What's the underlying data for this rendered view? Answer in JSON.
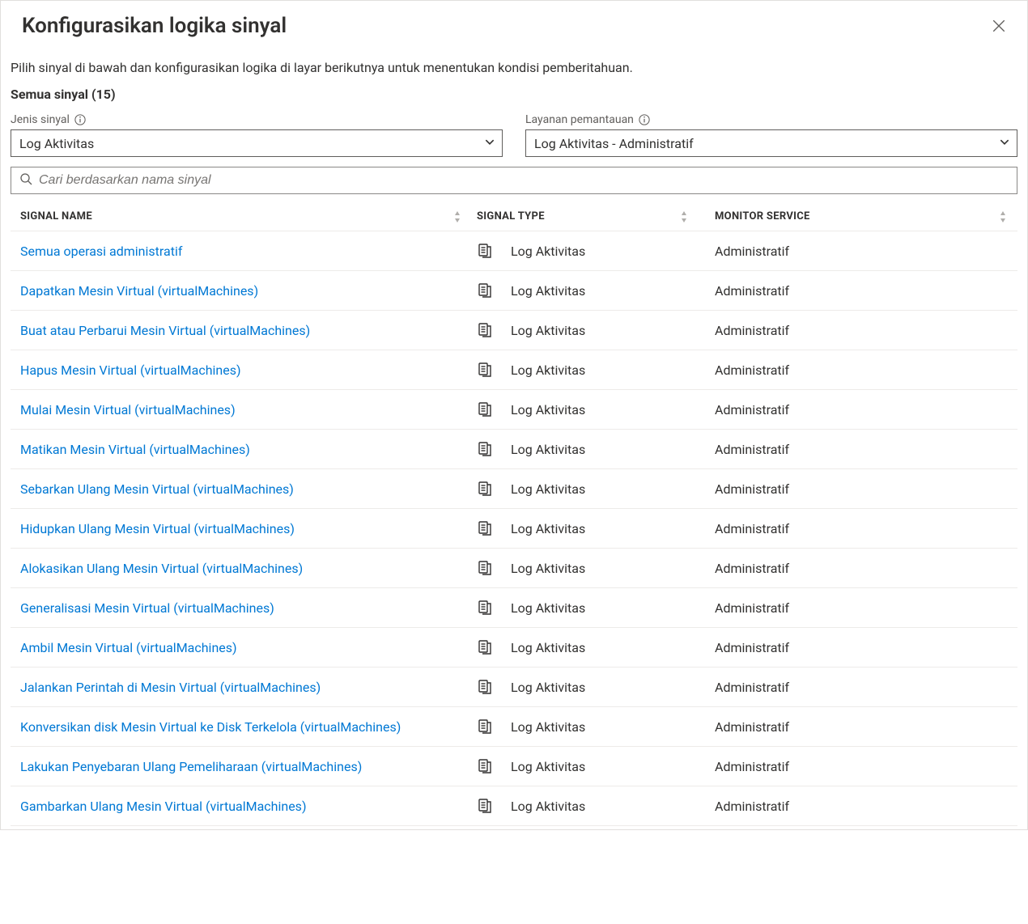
{
  "header": {
    "title": "Konfigurasikan logika sinyal",
    "description": "Pilih sinyal di bawah dan konfigurasikan logika di layar berikutnya untuk menentukan kondisi pemberitahuan.",
    "all_signals": "Semua sinyal (15)"
  },
  "filters": {
    "signal_type_label": "Jenis sinyal",
    "signal_type_value": "Log Aktivitas",
    "monitor_service_label": "Layanan pemantauan",
    "monitor_service_value": "Log Aktivitas - Administratif"
  },
  "search": {
    "placeholder": "Cari berdasarkan nama sinyal"
  },
  "columns": {
    "name": "Signal Name",
    "type": "Signal Type",
    "service": "Monitor Service"
  },
  "rows": [
    {
      "name": "Semua operasi administratif",
      "type": "Log Aktivitas",
      "service": "Administratif"
    },
    {
      "name": "Dapatkan Mesin Virtual (virtualMachines)",
      "type": "Log Aktivitas",
      "service": "Administratif"
    },
    {
      "name": "Buat atau Perbarui Mesin Virtual (virtualMachines)",
      "type": "Log Aktivitas",
      "service": "Administratif"
    },
    {
      "name": "Hapus Mesin Virtual (virtualMachines)",
      "type": "Log Aktivitas",
      "service": "Administratif"
    },
    {
      "name": "Mulai Mesin Virtual (virtualMachines)",
      "type": "Log Aktivitas",
      "service": "Administratif"
    },
    {
      "name": "Matikan Mesin Virtual (virtualMachines)",
      "type": "Log Aktivitas",
      "service": "Administratif"
    },
    {
      "name": "Sebarkan Ulang Mesin Virtual (virtualMachines)",
      "type": "Log Aktivitas",
      "service": "Administratif"
    },
    {
      "name": "Hidupkan Ulang Mesin Virtual (virtualMachines)",
      "type": "Log Aktivitas",
      "service": "Administratif"
    },
    {
      "name": "Alokasikan Ulang Mesin Virtual (virtualMachines)",
      "type": "Log Aktivitas",
      "service": "Administratif"
    },
    {
      "name": "Generalisasi Mesin Virtual (virtualMachines)",
      "type": "Log Aktivitas",
      "service": "Administratif"
    },
    {
      "name": "Ambil Mesin Virtual (virtualMachines)",
      "type": "Log Aktivitas",
      "service": "Administratif"
    },
    {
      "name": "Jalankan Perintah di Mesin Virtual (virtualMachines)",
      "type": "Log Aktivitas",
      "service": "Administratif"
    },
    {
      "name": "Konversikan disk Mesin Virtual ke Disk Terkelola (virtualMachines)",
      "type": "Log Aktivitas",
      "service": "Administratif"
    },
    {
      "name": "Lakukan Penyebaran Ulang Pemeliharaan (virtualMachines)",
      "type": "Log Aktivitas",
      "service": "Administratif"
    },
    {
      "name": "Gambarkan Ulang Mesin Virtual (virtualMachines)",
      "type": "Log Aktivitas",
      "service": "Administratif"
    }
  ]
}
